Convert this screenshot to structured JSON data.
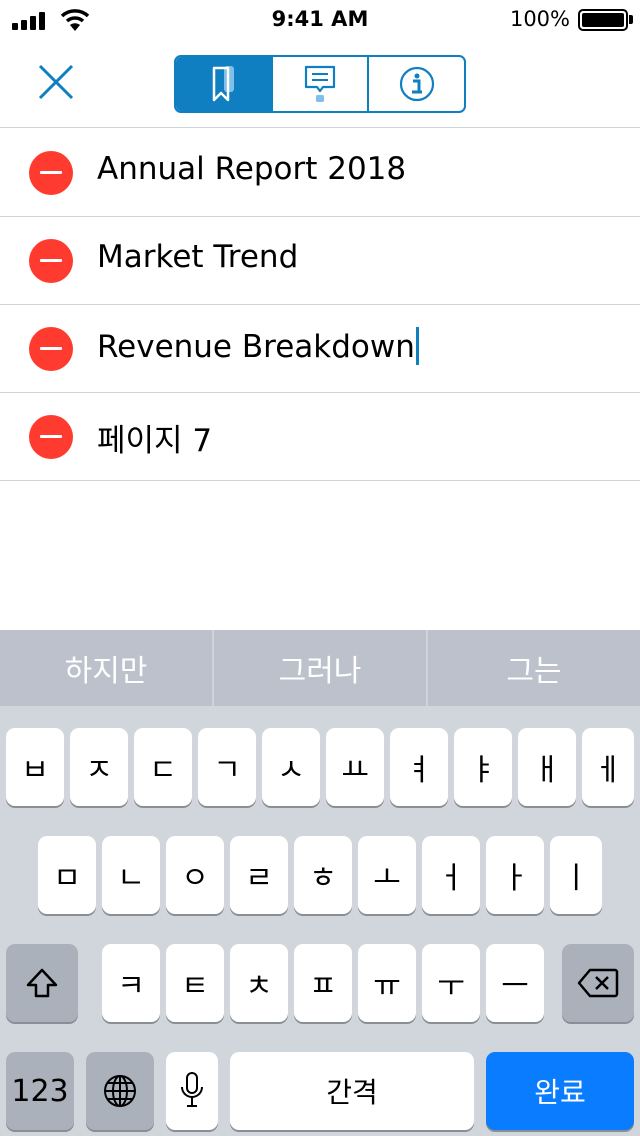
{
  "status_bar": {
    "time": "9:41 AM",
    "battery": "100%"
  },
  "nav": {
    "close_icon": "close-icon",
    "segments": [
      {
        "icon": "bookmark-icon",
        "active": true
      },
      {
        "icon": "comment-icon",
        "active": false
      },
      {
        "icon": "info-icon",
        "active": false
      }
    ],
    "accent_color": "#0f7fc2"
  },
  "list": {
    "items": [
      {
        "label": "Annual Report 2018"
      },
      {
        "label": "Market Trend"
      },
      {
        "label": "Revenue Breakdown",
        "editing": true
      },
      {
        "label": "페이지 7"
      }
    ],
    "delete_color": "#ff3b30"
  },
  "keyboard": {
    "suggestions": [
      "하지만",
      "그러나",
      "그는"
    ],
    "row1": [
      "ㅂ",
      "ㅈ",
      "ㄷ",
      "ㄱ",
      "ㅅ",
      "ㅛ",
      "ㅕ",
      "ㅑ",
      "ㅐ",
      "ㅔ"
    ],
    "row2": [
      "ㅁ",
      "ㄴ",
      "ㅇ",
      "ㄹ",
      "ㅎ",
      "ㅗ",
      "ㅓ",
      "ㅏ",
      "ㅣ"
    ],
    "row3": [
      "ㅋ",
      "ㅌ",
      "ㅊ",
      "ㅍ",
      "ㅠ",
      "ㅜ",
      "ㅡ"
    ],
    "numbers_label": "123",
    "space_label": "간격",
    "done_label": "완료",
    "shift_icon": "shift-icon",
    "backspace_icon": "backspace-icon",
    "globe_icon": "globe-icon",
    "mic_icon": "microphone-icon",
    "done_color": "#0a7cff"
  }
}
